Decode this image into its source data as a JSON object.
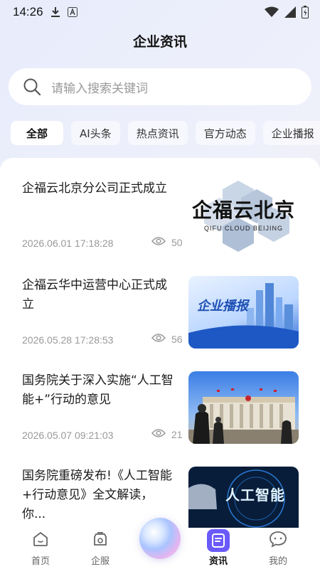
{
  "status_bar": {
    "time": "14:26"
  },
  "page_title": "企业资讯",
  "search": {
    "placeholder": "请输入搜索关键词"
  },
  "tabs": [
    {
      "label": "全部",
      "active": true
    },
    {
      "label": "AI头条",
      "active": false
    },
    {
      "label": "热点资讯",
      "active": false
    },
    {
      "label": "官方动态",
      "active": false
    },
    {
      "label": "企业播报",
      "active": false
    }
  ],
  "news": [
    {
      "title": "企福云北京分公司正式成立",
      "date": "2026.06.01 17:18:28",
      "views": "50",
      "thumb_title": "企福云北京",
      "thumb_sub": "QIFU CLOUD BEIJING"
    },
    {
      "title": "企福云华中运营中心正式成立",
      "date": "2026.05.28 17:28:53",
      "views": "56",
      "thumb_title": "企业播报"
    },
    {
      "title": "国务院关于深入实施“人工智能+”行动的意见",
      "date": "2026.05.07 09:21:03",
      "views": "21"
    },
    {
      "title": "国务院重磅发布!《人工智能+行动意见》全文解读，你...",
      "thumb_title": "人工智能"
    }
  ],
  "bottom_nav": [
    {
      "label": "首页",
      "icon": "home-icon",
      "active": false
    },
    {
      "label": "企服",
      "icon": "service-icon",
      "active": false
    },
    {
      "label": "资讯",
      "icon": "news-icon",
      "active": true
    },
    {
      "label": "我的",
      "icon": "profile-icon",
      "active": false
    }
  ],
  "colors": {
    "accent": "#6a5af9",
    "text_secondary": "#999999"
  }
}
